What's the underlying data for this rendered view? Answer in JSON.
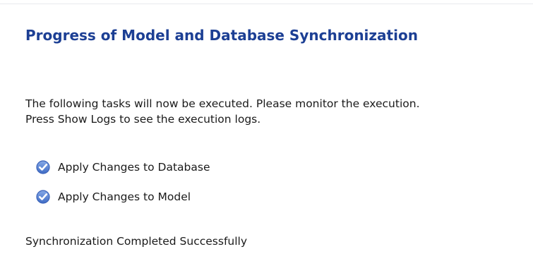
{
  "title": "Progress of Model and Database Synchronization",
  "description": {
    "line1": "The following tasks will now be executed. Please monitor the execution.",
    "line2": "Press Show Logs to see the execution logs."
  },
  "tasks": [
    {
      "label": "Apply Changes to Database",
      "icon": "check-circle-icon",
      "state": "completed"
    },
    {
      "label": "Apply Changes to Model",
      "icon": "check-circle-icon",
      "state": "completed"
    }
  ],
  "status": "Synchronization Completed Successfully",
  "colors": {
    "title": "#1c3f94",
    "check_fill": "#4a78d0",
    "check_mark": "#ffffff"
  }
}
